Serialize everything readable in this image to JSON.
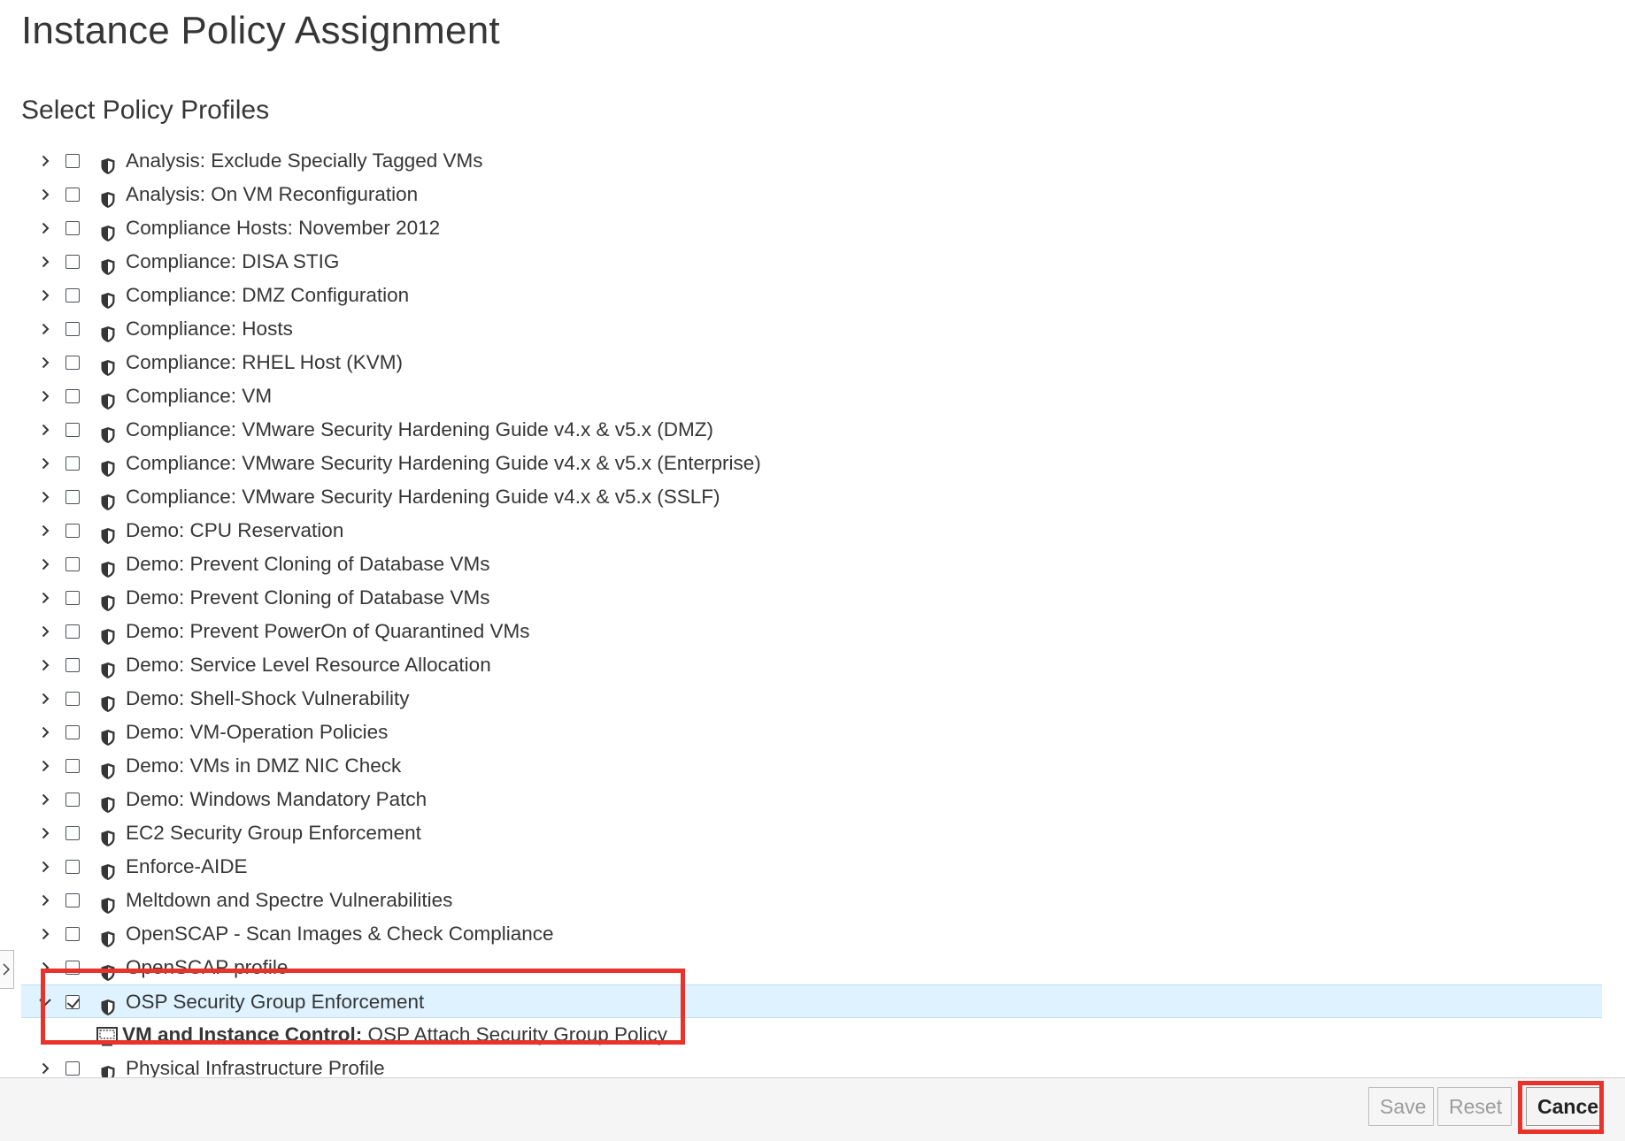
{
  "page_title": "Instance Policy Assignment",
  "section_title": "Select Policy Profiles",
  "profiles_before": [
    {
      "label": "Analysis: Exclude Specially Tagged VMs"
    },
    {
      "label": "Analysis: On VM Reconfiguration"
    },
    {
      "label": "Compliance Hosts: November 2012"
    },
    {
      "label": "Compliance: DISA STIG"
    },
    {
      "label": "Compliance: DMZ Configuration"
    },
    {
      "label": "Compliance: Hosts"
    },
    {
      "label": "Compliance: RHEL Host (KVM)"
    },
    {
      "label": "Compliance: VM"
    },
    {
      "label": "Compliance: VMware Security Hardening Guide v4.x & v5.x (DMZ)"
    },
    {
      "label": "Compliance: VMware Security Hardening Guide v4.x & v5.x (Enterprise)"
    },
    {
      "label": "Compliance: VMware Security Hardening Guide v4.x & v5.x (SSLF)"
    },
    {
      "label": "Demo: CPU Reservation"
    },
    {
      "label": "Demo: Prevent Cloning of Database VMs"
    },
    {
      "label": "Demo: Prevent Cloning of Database VMs"
    },
    {
      "label": "Demo: Prevent PowerOn of Quarantined VMs"
    },
    {
      "label": "Demo: Service Level Resource Allocation"
    },
    {
      "label": "Demo: Shell-Shock Vulnerability"
    },
    {
      "label": "Demo: VM-Operation Policies"
    },
    {
      "label": "Demo: VMs in DMZ NIC Check"
    },
    {
      "label": "Demo: Windows Mandatory Patch"
    },
    {
      "label": "EC2 Security Group Enforcement"
    },
    {
      "label": "Enforce-AIDE"
    },
    {
      "label": "Meltdown and Spectre Vulnerabilities"
    },
    {
      "label": "OpenSCAP - Scan Images & Check Compliance"
    },
    {
      "label": "OpenSCAP profile"
    }
  ],
  "selected_profile": {
    "label": "OSP Security Group Enforcement",
    "checked": true,
    "expanded": true,
    "child": {
      "category": "VM and Instance Control:",
      "policy": " OSP Attach Security Group Policy"
    }
  },
  "profiles_after": [
    {
      "label": "Physical Infrastructure Profile"
    }
  ],
  "footer": {
    "save_label": "Save",
    "reset_label": "Reset",
    "cancel_label": "Cancel"
  },
  "colors": {
    "highlight": "#e8322a",
    "selected_row_bg": "#def3ff"
  },
  "icons": {
    "profile": "shield-icon",
    "policy": "monitor-icon",
    "expander": "chevron-right-icon"
  }
}
